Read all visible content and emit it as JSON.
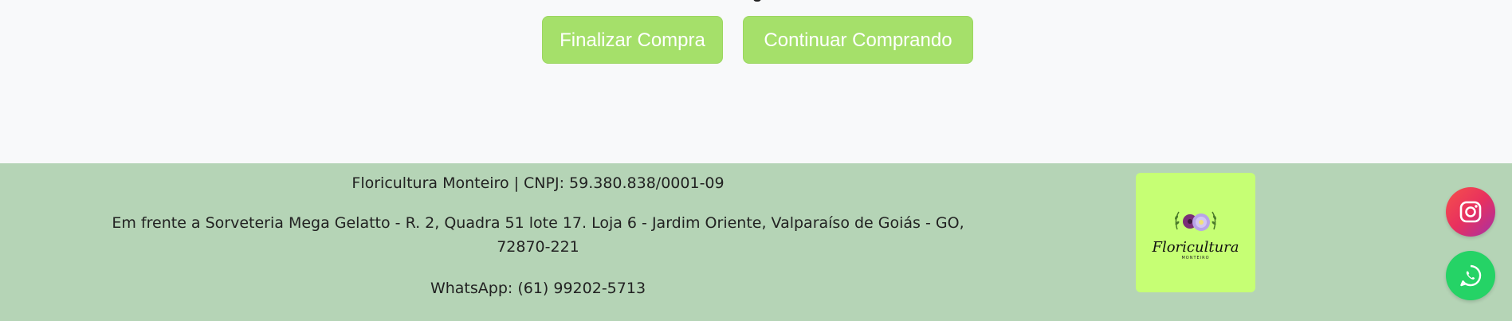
{
  "buttons": {
    "finalizar": "Finalizar Compra",
    "continuar": "Continuar Comprando"
  },
  "footer": {
    "company_line": "Floricultura Monteiro | CNPJ: 59.380.838/0001-09",
    "address": "Em frente a Sorveteria Mega Gelatto - R. 2, Quadra 51 lote 17. Loja 6 - Jardim Oriente, Valparaíso de Goiás - GO, 72870-221",
    "whatsapp": "WhatsApp: (61) 99202-5713"
  },
  "logo": {
    "title": "Floricultura",
    "subtitle": "MONTEIRO"
  },
  "floating": {
    "instagram_icon": "instagram-icon",
    "whatsapp_icon": "whatsapp-icon"
  },
  "colors": {
    "button_bg": "#a5e06a",
    "footer_bg": "#b5d4b6",
    "logo_bg": "#c6ff74",
    "whatsapp": "#25d366"
  }
}
